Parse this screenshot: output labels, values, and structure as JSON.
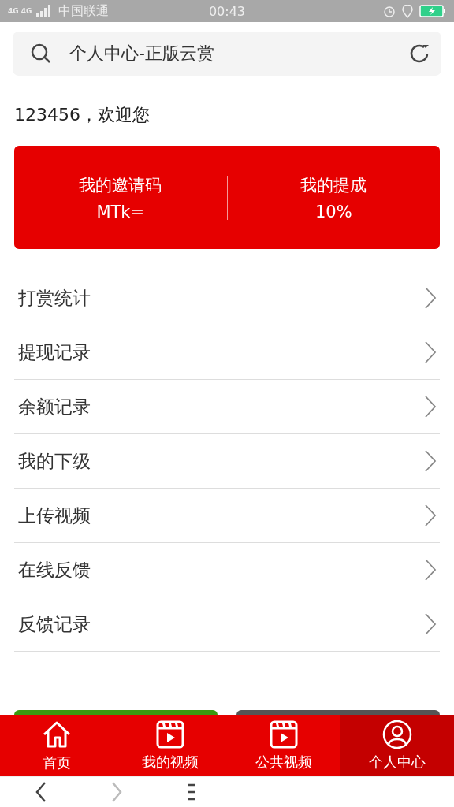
{
  "status_bar": {
    "network": "4G 4G",
    "carrier": "中国联通",
    "time": "00:43"
  },
  "address_bar": {
    "title": "个人中心-正版云赏"
  },
  "greeting": "123456，欢迎您",
  "stats_card": [
    {
      "label": "我的邀请码",
      "value": "MTk="
    },
    {
      "label": "我的提成",
      "value": "10%"
    }
  ],
  "menu": [
    {
      "label": "打赏统计"
    },
    {
      "label": "提现记录"
    },
    {
      "label": "余额记录"
    },
    {
      "label": "我的下级"
    },
    {
      "label": "上传视频"
    },
    {
      "label": "在线反馈"
    },
    {
      "label": "反馈记录"
    }
  ],
  "partial_buttons": [
    {
      "color": "#3a9a10"
    },
    {
      "color": "#555555"
    }
  ],
  "tab_bar": [
    {
      "label": "首页",
      "kind": "home",
      "selected": false
    },
    {
      "label": "我的视频",
      "kind": "video",
      "selected": false
    },
    {
      "label": "公共视频",
      "kind": "video",
      "selected": false
    },
    {
      "label": "个人中心",
      "kind": "user",
      "selected": true
    }
  ],
  "browser_bar": [
    {
      "kind": "back",
      "disabled": false
    },
    {
      "kind": "forward",
      "disabled": true
    },
    {
      "kind": "menu",
      "disabled": false
    }
  ]
}
